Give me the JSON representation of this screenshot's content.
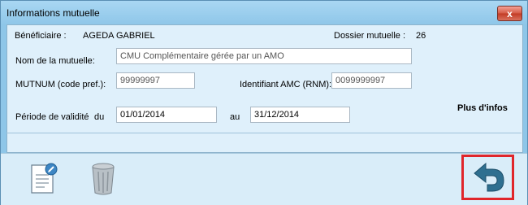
{
  "window": {
    "title": "Informations mutuelle",
    "close_glyph": "x"
  },
  "beneficiaire": {
    "label": "Bénéficiaire :",
    "value": "AGEDA GABRIEL"
  },
  "dossier": {
    "label": "Dossier mutuelle :",
    "value": "26"
  },
  "nom_mutuelle": {
    "label": "Nom de la mutuelle:",
    "value": "CMU Complémentaire gérée par un AMO"
  },
  "mutnum": {
    "label": "MUTNUM (code pref.):",
    "value": "99999997"
  },
  "amc": {
    "label": "Identifiant AMC (RNM):",
    "value": "0099999997"
  },
  "periode": {
    "label": "Période de validité",
    "du_label": "du",
    "du_value": "01/01/2014",
    "au_label": "au",
    "au_value": "31/12/2014"
  },
  "plus_infos": "Plus d'infos",
  "icons": {
    "edit": "edit-document-icon",
    "delete": "trash-can-icon",
    "return": "return-arrow-icon"
  },
  "colors": {
    "window_bg": "#8ec6e8",
    "content_bg": "#dff0fb",
    "highlight": "#e0262b",
    "return_arrow": "#2e6f90"
  }
}
